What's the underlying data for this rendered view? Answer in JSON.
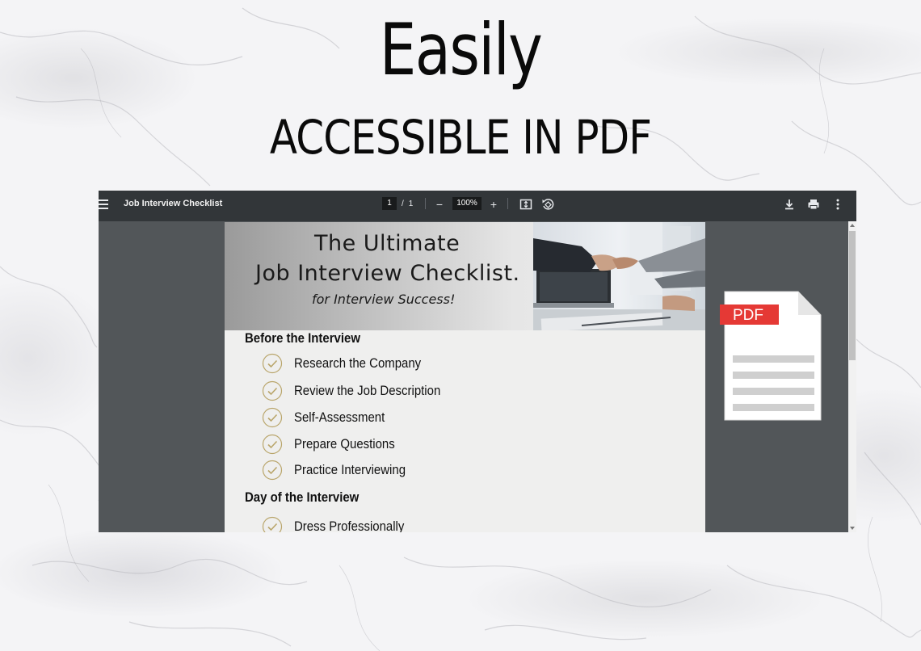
{
  "hero": {
    "title": "Easily",
    "subtitle": "ACCESSIBLE IN PDF"
  },
  "viewer": {
    "toolbar": {
      "menu_icon": "hamburger-menu-icon",
      "document_title": "Job Interview Checklist",
      "current_page": "1",
      "page_separator": "/",
      "total_pages": "1",
      "zoom_out": "−",
      "zoom_level": "100%",
      "zoom_in": "+",
      "fit_icon": "fit-to-page-icon",
      "rotate_icon": "rotate-icon",
      "download_icon": "download-icon",
      "print_icon": "print-icon",
      "more_icon": "more-vertical-icon"
    },
    "document": {
      "title_line_1": "The Ultimate",
      "title_line_2": "Job Interview Checklist.",
      "tagline": "for Interview Success!",
      "sections": [
        {
          "heading": "Before the Interview",
          "items": [
            "Research the Company",
            "Review the Job Description",
            "Self-Assessment",
            "Prepare Questions",
            "Practice Interviewing"
          ]
        },
        {
          "heading": "Day of the Interview",
          "items": [
            "Dress Professionally"
          ]
        }
      ]
    }
  },
  "pdf_icon": {
    "label": "PDF",
    "accent_color": "#e53935"
  },
  "colors": {
    "toolbar_bg": "#323639",
    "viewer_bg": "#525659",
    "check_gold": "#b9a56a"
  }
}
